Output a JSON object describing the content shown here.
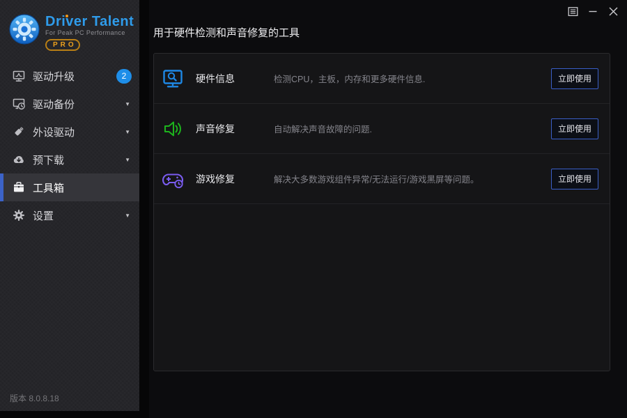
{
  "logo": {
    "title": "Driver Talent",
    "subtitle": "For Peak PC Performance",
    "badge": "PRO"
  },
  "sidebar": {
    "items": [
      {
        "label": "驱动升级",
        "icon": "driver-update-icon",
        "badge": "2"
      },
      {
        "label": "驱动备份",
        "icon": "driver-backup-icon",
        "expandable": true
      },
      {
        "label": "外设驱动",
        "icon": "peripheral-driver-icon",
        "expandable": true
      },
      {
        "label": "预下载",
        "icon": "predownload-icon",
        "expandable": true
      },
      {
        "label": "工具箱",
        "icon": "toolbox-icon",
        "selected": true
      },
      {
        "label": "设置",
        "icon": "settings-gear-icon",
        "expandable": true
      }
    ],
    "version": "版本 8.0.8.18"
  },
  "main": {
    "title": "用于硬件检测和声音修复的工具",
    "tools": [
      {
        "name": "硬件信息",
        "description": "检测CPU，主板，内存和更多硬件信息.",
        "icon": "hardware-info-icon",
        "icon_color": "#1e88e5",
        "button": "立即使用"
      },
      {
        "name": "声音修复",
        "description": "自动解决声音故障的问题.",
        "icon": "sound-repair-icon",
        "icon_color": "#1db31d",
        "button": "立即使用"
      },
      {
        "name": "游戏修复",
        "description": "解决大多数游戏组件异常/无法运行/游戏黑屏等问题。",
        "icon": "game-repair-icon",
        "icon_color": "#7a5cf0",
        "button": "立即使用"
      }
    ]
  },
  "icons": {
    "chevron_down": "▼"
  },
  "colors": {
    "accent_blue": "#2f9ceb",
    "selected_bar_blue": "#3c63c8",
    "badge_blue": "#1e8ee9",
    "pro_orange": "#eea11d",
    "button_border_blue": "#3a5fc8",
    "sidebar_bg": "#232327",
    "panel_bg": "#151517"
  }
}
